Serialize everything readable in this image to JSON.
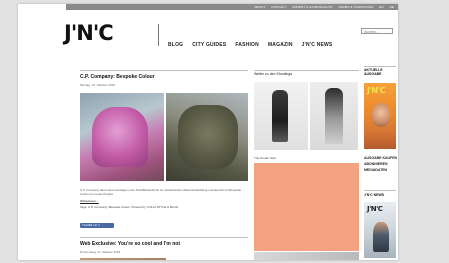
{
  "topnav": [
    "ABOUT",
    "CONTACT",
    "IMPRINT & DATENSCHUTZ",
    "TERMS & CONDITIONS",
    "EN",
    "DE"
  ],
  "logo": "J'N'C",
  "mainnav": [
    "BLOG",
    "CITY GUIDES",
    "FASHION",
    "MAGAZIN",
    "J'N'C NEWS"
  ],
  "search": {
    "placeholder": "Suchen..."
  },
  "article1": {
    "title": "C.P. Company: Bespoke Colour",
    "date": "Montag, 15. Oktober 2018",
    "body": "C.P. Company dient seine Heritage in der Textilfärbetechnik zur fortlaufenden Weiterentwicklung und launcht mit Bespoke Colour ein neues Projekt.",
    "more": "Weiterlesen…",
    "links": "Tags: C.P. Company, Bespoke Colour | Posted by: FOLIA STYLE & BLOG",
    "fb": "f Gefällt mir 1"
  },
  "article2": {
    "title": "Web Exclusive: You’re so cool and I’m not",
    "date": "Donnerstag, 11. Oktober 2018"
  },
  "middle": {
    "heading": "Weiter zu den Shootings",
    "caption": "The Tender Spot"
  },
  "right": {
    "heading": "AKTUELLE AUSGABE",
    "cover1_masthead": "J'N'C",
    "links": [
      "AUSGABE KAUFEN",
      "ABONNIEREN",
      "MEDIADATEN"
    ],
    "news_heading": "J'N'C NEWS",
    "cover2_masthead": "J'N'C"
  },
  "colors": {
    "ad": "#f3a382",
    "topbar": "#8a8a8a"
  }
}
